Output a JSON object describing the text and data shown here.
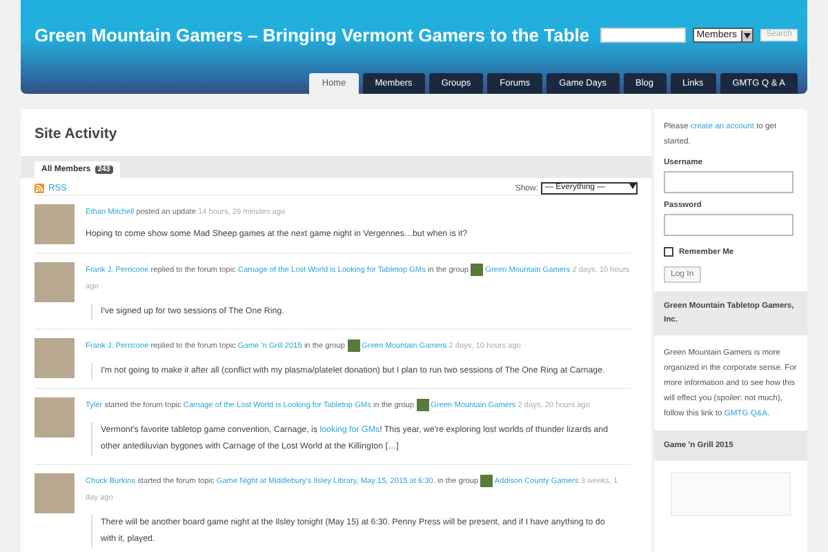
{
  "header": {
    "title": "Green Mountain Gamers – Bringing Vermont Gamers to the Table",
    "search": {
      "select": "Members",
      "button": "Search"
    },
    "nav": [
      {
        "label": "Home",
        "selected": true
      },
      {
        "label": "Members",
        "selected": false
      },
      {
        "label": "Groups",
        "selected": false
      },
      {
        "label": "Forums",
        "selected": false
      },
      {
        "label": "Game Days",
        "selected": false
      },
      {
        "label": "Blog",
        "selected": false
      },
      {
        "label": "Links",
        "selected": false
      },
      {
        "label": "GMTG Q & A",
        "selected": false
      }
    ]
  },
  "main": {
    "title": "Site Activity",
    "tabs": [
      {
        "label": "All Members",
        "count": "243",
        "selected": true
      }
    ],
    "rss": "RSS",
    "filter": {
      "label": "Show:",
      "value": "— Everything —"
    },
    "activities": [
      {
        "header": [
          {
            "kind": "link",
            "text": "Ethan Mitchell"
          },
          {
            "kind": "text",
            "text": "posted an update"
          },
          {
            "kind": "time",
            "text": "14 hours, 29 minutes ago"
          }
        ],
        "quoted": false,
        "content": [
          {
            "kind": "text",
            "text": "Hoping to come show some Mad Sheep games at the next game night in Vergennes…but when is it?"
          }
        ]
      },
      {
        "header": [
          {
            "kind": "link",
            "text": "Frank J. Perricone"
          },
          {
            "kind": "text",
            "text": "replied to the forum topic"
          },
          {
            "kind": "link",
            "text": "Carnage of the Lost World is Looking for Tabletop GMs"
          },
          {
            "kind": "text",
            "text": "in the group"
          },
          {
            "kind": "group-icon"
          },
          {
            "kind": "link",
            "text": "Green Mountain Gamers"
          },
          {
            "kind": "time",
            "text": "2 days, 10 hours ago"
          }
        ],
        "quoted": true,
        "content": [
          {
            "kind": "text",
            "text": "I've signed up for two sessions of The One Ring."
          }
        ]
      },
      {
        "header": [
          {
            "kind": "link",
            "text": "Frank J. Perricone"
          },
          {
            "kind": "text",
            "text": "replied to the forum topic"
          },
          {
            "kind": "link",
            "text": "Game 'n Grill 2015"
          },
          {
            "kind": "text",
            "text": "in the group"
          },
          {
            "kind": "group-icon"
          },
          {
            "kind": "link",
            "text": "Green Mountain Gamers"
          },
          {
            "kind": "time",
            "text": "2 days, 10 hours ago"
          }
        ],
        "quoted": true,
        "content": [
          {
            "kind": "text",
            "text": "I'm not going to make it after all (conflict with my plasma/platelet donation) but I plan to run two sessions of The One Ring at Carnage."
          }
        ]
      },
      {
        "header": [
          {
            "kind": "link",
            "text": "Tyler"
          },
          {
            "kind": "text",
            "text": "started the forum topic"
          },
          {
            "kind": "link",
            "text": "Carnage of the Lost World is Looking for Tabletop GMs"
          },
          {
            "kind": "text",
            "text": "in the group"
          },
          {
            "kind": "group-icon"
          },
          {
            "kind": "link",
            "text": "Green Mountain Gamers"
          },
          {
            "kind": "time",
            "text": "2 days, 20 hours ago"
          }
        ],
        "quoted": true,
        "content": [
          {
            "kind": "text",
            "text": "Vermont's favorite tabletop game convention, Carnage, is"
          },
          {
            "kind": "link",
            "text": "looking for GMs"
          },
          {
            "kind": "text",
            "text": "! This year, we're exploring lost worlds of thunder lizards and other antediluvian bygones with Carnage of the Lost World at the Killington […]"
          }
        ]
      },
      {
        "header": [
          {
            "kind": "link",
            "text": "Chuck Burkins"
          },
          {
            "kind": "text",
            "text": "started the forum topic"
          },
          {
            "kind": "link",
            "text": "Game Night at Middlebury's Ilsley Library, May 15, 2015 at 6:30."
          },
          {
            "kind": "text",
            "text": "in the group"
          },
          {
            "kind": "group-icon"
          },
          {
            "kind": "link",
            "text": "Addison County Gamers"
          },
          {
            "kind": "time",
            "text": "3 weeks, 1 day ago"
          }
        ],
        "quoted": true,
        "content": [
          {
            "kind": "text",
            "text": "There will be another board game night at the Ilsley tonight (May 15) at 6:30. Penny Press will be present, and if I have anything to do with it, played."
          }
        ]
      }
    ]
  },
  "sidebar": {
    "login": {
      "intro": [
        {
          "kind": "text",
          "text": "Please"
        },
        {
          "kind": "link",
          "text": "create an account"
        },
        {
          "kind": "text",
          "text": "to get started."
        }
      ],
      "username": "Username",
      "password": "Password",
      "remember": {
        "label": "Remember Me",
        "checked": false
      },
      "button": "Log In"
    },
    "widgets": [
      {
        "kind": "text",
        "title": "Green Mountain Tabletop Gamers, Inc.",
        "body": [
          {
            "kind": "text",
            "text": "Green Mountain Gamers is more organized in the corporate sense. For more information and to see how this will effect you (spoiler: not much), follow this link to"
          },
          {
            "kind": "link",
            "text": "GMTG Q&A"
          },
          {
            "kind": "text",
            "text": "."
          }
        ]
      },
      {
        "kind": "poster",
        "title": "Game 'n Grill 2015"
      }
    ]
  }
}
